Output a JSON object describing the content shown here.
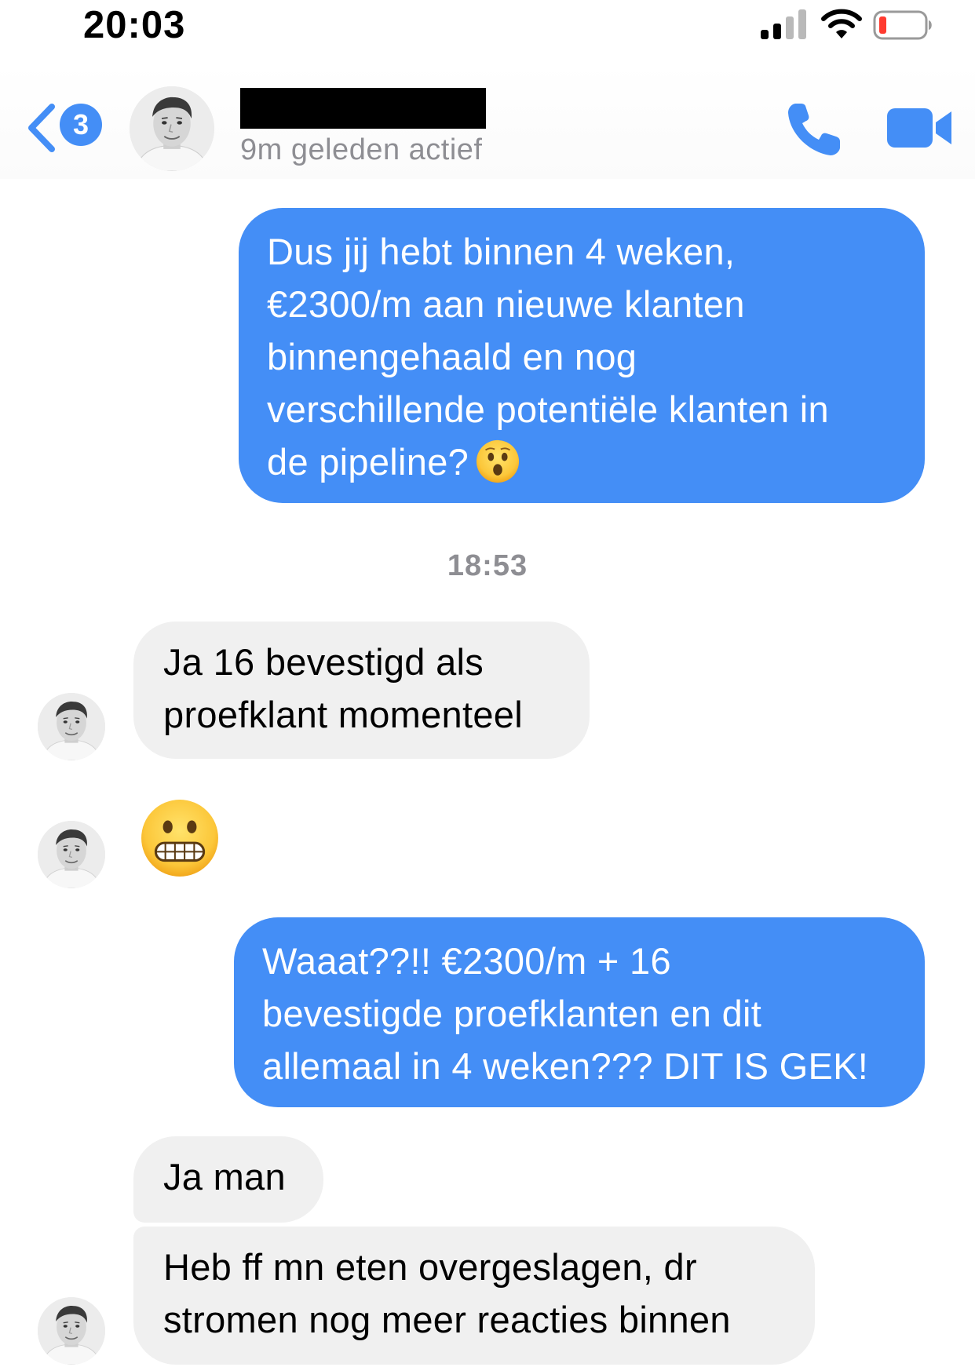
{
  "status_bar": {
    "time": "20:03"
  },
  "header": {
    "back_badge_count": "3",
    "contact_name_redacted": true,
    "presence": "9m geleden actief"
  },
  "colors": {
    "accent": "#448EF6",
    "incoming_bubble": "#F0F0F0",
    "secondary_text": "#8E8E93"
  },
  "messages": {
    "m1": {
      "direction": "outgoing",
      "lines": [
        "Dus jij hebt binnen 4 weken,",
        "€2300/m aan nieuwe klanten",
        "binnengehaald en nog",
        "verschillende potentiële klanten in",
        "de pipeline?"
      ],
      "emoji": "hushed-face-emoji"
    },
    "timestamp": "18:53",
    "m2": {
      "direction": "incoming",
      "lines": [
        "Ja 16 bevestigd als",
        "proefklant momenteel"
      ]
    },
    "m3": {
      "direction": "incoming",
      "emoji": "grimacing-face-emoji"
    },
    "m4": {
      "direction": "outgoing",
      "lines": [
        "Waaat??!! €2300/m + 16",
        "bevestigde proefklanten en dit",
        "allemaal in 4 weken??? DIT IS GEK!"
      ]
    },
    "m5": {
      "direction": "incoming",
      "lines": [
        "Ja man"
      ]
    },
    "m6": {
      "direction": "incoming",
      "lines": [
        "Heb ff mn eten overgeslagen, dr",
        "stromen nog meer reacties binnen"
      ]
    }
  },
  "icons": [
    "signal-icon",
    "wifi-icon",
    "battery-icon",
    "chevron-left-icon",
    "phone-icon",
    "video-camera-icon"
  ]
}
